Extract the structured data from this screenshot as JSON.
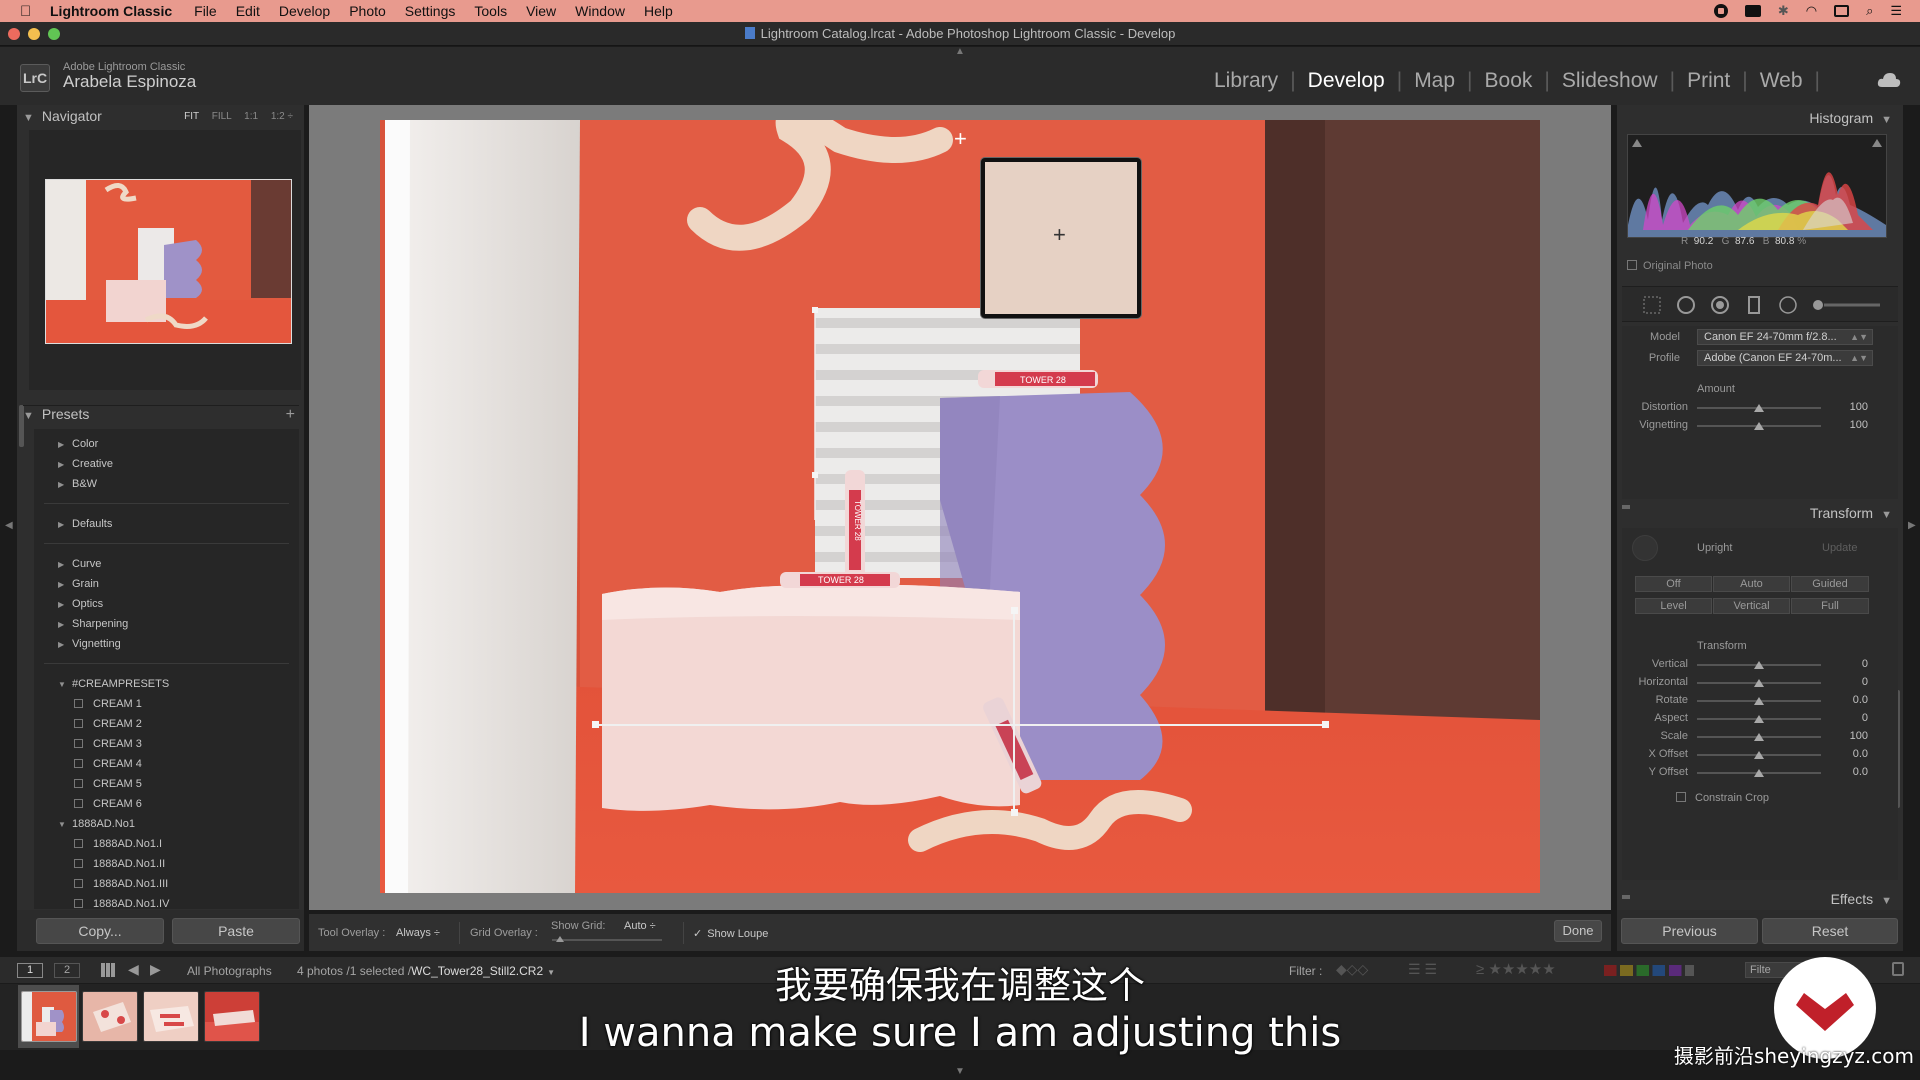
{
  "menubar": {
    "items": [
      "Lightroom Classic",
      "File",
      "Edit",
      "Develop",
      "Photo",
      "Settings",
      "Tools",
      "View",
      "Window",
      "Help"
    ]
  },
  "window": {
    "title": "Lightroom Catalog.lrcat - Adobe Photoshop Lightroom Classic - Develop"
  },
  "identity": {
    "badge": "LrC",
    "app_name": "Adobe Lightroom Classic",
    "user_name": "Arabela Espinoza"
  },
  "modules": {
    "items": [
      "Library",
      "Develop",
      "Map",
      "Book",
      "Slideshow",
      "Print",
      "Web"
    ],
    "active": "Develop"
  },
  "navigator": {
    "title": "Navigator",
    "zoom_options": [
      "FIT",
      "FILL",
      "1:1",
      "1:2 ÷"
    ]
  },
  "presets": {
    "title": "Presets",
    "add": "+",
    "groups_a": [
      "Color",
      "Creative",
      "B&W"
    ],
    "groups_b": [
      "Defaults"
    ],
    "groups_c": [
      "Curve",
      "Grain",
      "Optics",
      "Sharpening",
      "Vignetting"
    ],
    "cream_group": "#CREAMPRESETS",
    "cream_items": [
      "CREAM 1",
      "CREAM 2",
      "CREAM 3",
      "CREAM 4",
      "CREAM 5",
      "CREAM 6"
    ],
    "ad_group": "1888AD.No1",
    "ad_items": [
      "1888AD.No1.I",
      "1888AD.No1.II",
      "1888AD.No1.III",
      "1888AD.No1.IV"
    ]
  },
  "left_buttons": {
    "copy": "Copy...",
    "paste": "Paste"
  },
  "toolbar": {
    "tool_overlay_label": "Tool Overlay :",
    "tool_overlay_value": "Always ÷",
    "grid_overlay_label": "Grid Overlay :",
    "show_grid_label": "Show Grid:",
    "show_grid_value": "Auto ÷",
    "show_loupe": "Show Loupe",
    "done": "Done"
  },
  "photo_labels": {
    "brand": "TOWER 28"
  },
  "histogram": {
    "title": "Histogram",
    "r_label": "R",
    "r": "90.2",
    "g_label": "G",
    "g": "87.6",
    "b_label": "B",
    "b": "80.8",
    "unit": "%",
    "original_photo": "Original Photo"
  },
  "lens": {
    "model_label": "Model",
    "model_value": "Canon EF 24-70mm f/2.8...",
    "profile_label": "Profile",
    "profile_value": "Adobe (Canon EF 24-70m...",
    "amount_label": "Amount",
    "distortion_label": "Distortion",
    "distortion": "100",
    "vignetting_label": "Vignetting",
    "vignetting": "100"
  },
  "transform": {
    "title": "Transform",
    "upright_label": "Upright",
    "update": "Update",
    "buttons_row1": [
      "Off",
      "Auto",
      "Guided"
    ],
    "buttons_row2": [
      "Level",
      "Vertical",
      "Full"
    ],
    "sub_title": "Transform",
    "sliders": [
      {
        "label": "Vertical",
        "value": "0"
      },
      {
        "label": "Horizontal",
        "value": "0"
      },
      {
        "label": "Rotate",
        "value": "0.0"
      },
      {
        "label": "Aspect",
        "value": "0"
      },
      {
        "label": "Scale",
        "value": "100"
      },
      {
        "label": "X Offset",
        "value": "0.0"
      },
      {
        "label": "Y Offset",
        "value": "0.0"
      }
    ],
    "constrain_crop": "Constrain Crop"
  },
  "effects": {
    "title": "Effects"
  },
  "right_buttons": {
    "previous": "Previous",
    "reset": "Reset"
  },
  "filmbar": {
    "view1": "1",
    "view2": "2",
    "source": "All Photographs",
    "count": "4 photos /1 selected /",
    "filename": "WC_Tower28_Still2.CR2",
    "filter_label": "Filter :",
    "filter_btn": "Filte"
  },
  "subtitles": {
    "cn": "我要确保我在调整这个",
    "en": "I wanna make sure I am adjusting this"
  },
  "watermark": {
    "text": "摄影前沿sheyingzyz.com"
  }
}
